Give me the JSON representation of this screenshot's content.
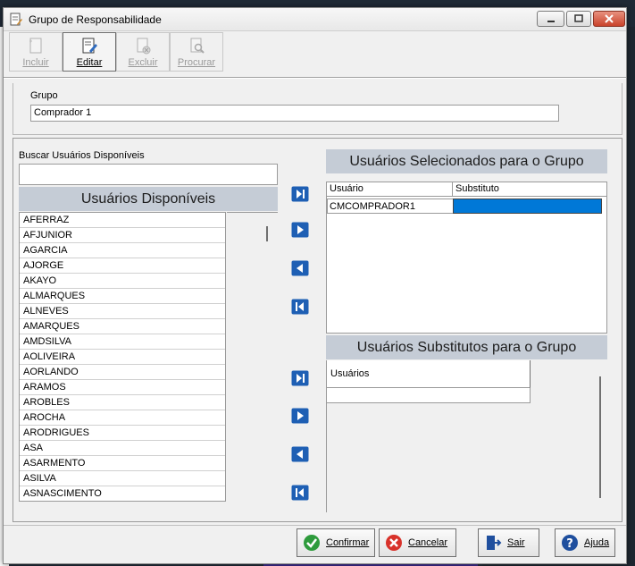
{
  "window": {
    "title": "Grupo de Responsabilidade"
  },
  "toolbar": {
    "incluir": "Incluir",
    "editar": "Editar",
    "excluir": "Excluir",
    "procurar": "Procurar"
  },
  "grupo": {
    "label": "Grupo",
    "value": "Comprador 1"
  },
  "buscar": {
    "label": "Buscar Usuários Disponíveis",
    "value": ""
  },
  "disponiveis": {
    "header": "Usuários Disponíveis",
    "items": [
      "AFERRAZ",
      "AFJUNIOR",
      "AGARCIA",
      "AJORGE",
      "AKAYO",
      "ALMARQUES",
      "ALNEVES",
      "AMARQUES",
      "AMDSILVA",
      "AOLIVEIRA",
      "AORLANDO",
      "ARAMOS",
      "AROBLES",
      "AROCHA",
      "ARODRIGUES",
      "ASA",
      "ASARMENTO",
      "ASILVA",
      "ASNASCIMENTO"
    ]
  },
  "selecionados": {
    "header": "Usuários Selecionados para o Grupo",
    "col_usuario": "Usuário",
    "col_substituto": "Substituto",
    "rows": [
      {
        "usuario": "CMCOMPRADOR1",
        "substituto": ""
      }
    ]
  },
  "substitutos": {
    "header": "Usuários Substitutos para o Grupo",
    "col_usuarios": "Usuários"
  },
  "actions": {
    "confirmar": "Confirmar",
    "cancelar": "Cancelar",
    "sair": "Sair",
    "ajuda": "Ajuda"
  },
  "colors": {
    "header_bg": "#c5ccd6",
    "selection": "#0078d7",
    "arrow_blue": "#1e5fb4",
    "confirm_green": "#2e9b3c",
    "cancel_red": "#d8322a",
    "help_blue": "#1f4f9e"
  }
}
